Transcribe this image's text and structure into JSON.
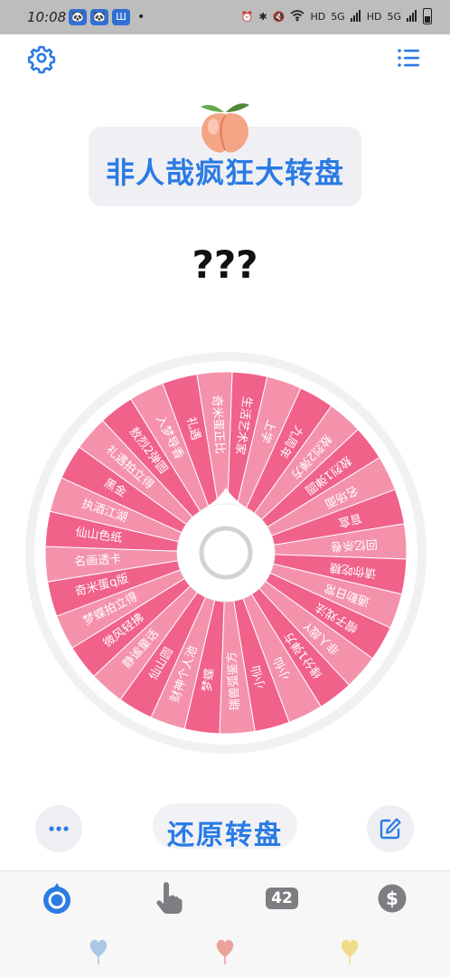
{
  "status_bar": {
    "time": "10:08",
    "apps": [
      "🐼",
      "🐼",
      "Ш"
    ],
    "dot": "•",
    "network": [
      "HD",
      "5G",
      "HD",
      "5G"
    ]
  },
  "header": {
    "settings_icon": "gear-icon",
    "menu_icon": "list-icon"
  },
  "title": {
    "text": "非人哉疯狂大转盘",
    "decoration_icon": "peach-icon"
  },
  "result": {
    "text": "???"
  },
  "wheel": {
    "colors": [
      "#f0628a",
      "#f492ac"
    ],
    "segments": [
      "生活艺术家",
      "上学",
      "九周年",
      "敖烈2弹方",
      "敖烈1弹圆",
      "名场面",
      "盲盒",
      "回忆杀卷",
      "请你吃糖",
      "通勤日常",
      "帽子戏法",
      "非人哉Y",
      "缘分1弹方",
      "小仙",
      "小仙",
      "瑞兽弧鉴方",
      "梦蝶",
      "财神个人池",
      "仙山圆",
      "静谧童话",
      "微风轻拂",
      "梦蝶拍立得",
      "奇米蛋q版",
      "名画透卡",
      "仙山色纸",
      "执酒江湖",
      "黑金",
      "礼遇拍立得",
      "敖烈2弹圆",
      "入梦导香",
      "礼遇",
      "奇米蛋正比"
    ]
  },
  "controls": {
    "more_icon": "more-icon",
    "restore_label": "还原转盘",
    "edit_icon": "edit-icon"
  },
  "tabbar": {
    "tab1_icon": "wheel-icon",
    "tab2_icon": "tap-hand-icon",
    "count": "42",
    "tab4_icon": "dollar-icon",
    "active_color": "#2a7be4"
  },
  "hearts": [
    "#aac6e8",
    "#eba29a",
    "#f0dc88"
  ]
}
